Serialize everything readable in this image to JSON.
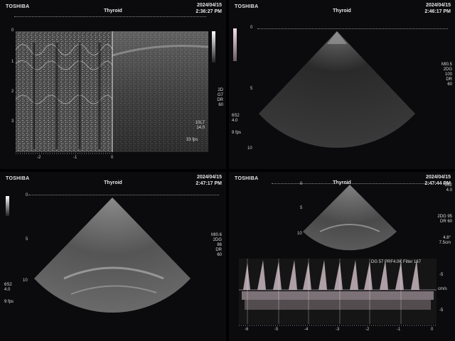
{
  "panels": [
    {
      "brand": "TOSHIBA",
      "title": "Thyroid",
      "date": "2024/04/15",
      "time": "2:36:27 PM",
      "mode": "M-mode",
      "depth_labels": [
        "0",
        "1",
        "2",
        "3"
      ],
      "time_labels": [
        "-2",
        "-1",
        "0"
      ],
      "params": [
        "2D",
        "G7",
        "DR",
        "60"
      ],
      "params2": [
        "10L7",
        "14.0"
      ],
      "fps": "33 fps"
    },
    {
      "brand": "TOSHIBA",
      "title": "Thyroid",
      "date": "2024/04/15",
      "time": "2:46:17 PM",
      "depth_labels": [
        "0",
        "5",
        "10"
      ],
      "params": [
        "MI0.5",
        "2DG",
        "100",
        "DR",
        "60"
      ],
      "params2": [
        "6S2",
        "4.0"
      ],
      "fps": "9 fps"
    },
    {
      "brand": "TOSHIBA",
      "title": "Thyroid",
      "date": "2024/04/15",
      "time": "2:47:17 PM",
      "depth_labels": [
        "0",
        "5",
        "10"
      ],
      "params": [
        "MI0.6",
        "2DG",
        "86",
        "DR",
        "60"
      ],
      "params2": [
        "6S2",
        "4.0"
      ],
      "fps": "9 fps"
    },
    {
      "brand": "TOSHIBA",
      "title": "Thyroid",
      "date": "2024/04/15",
      "time": "2:47:44 PM",
      "depth_labels": [
        "0",
        "5",
        "10"
      ],
      "params": [
        "6S2",
        "4.0",
        "2DG 95",
        "DR 60"
      ],
      "params2": [
        "4.8°",
        "7.5cm"
      ],
      "doppler_header": "DG 57 PRF4.0K Filter 167",
      "doppler_scale": [
        "-5",
        "-5",
        "cm/s"
      ],
      "time_labels": [
        "-6",
        "-5",
        "-4",
        "-3",
        "-2",
        "-1",
        "0"
      ]
    }
  ]
}
